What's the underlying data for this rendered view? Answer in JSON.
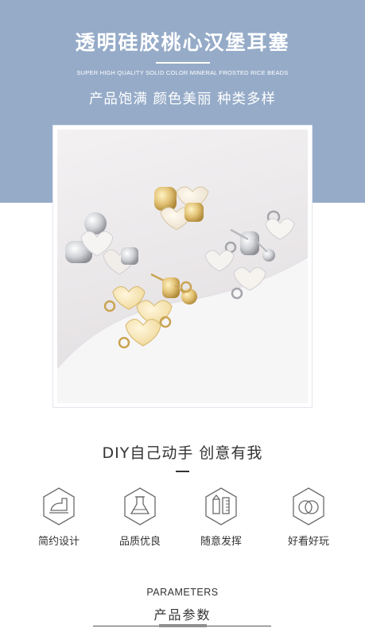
{
  "header": {
    "title": "透明硅胶桃心汉堡耳塞",
    "subtitle_en": "SUPER HIGH QUALITY SOLID COLOR MINERAL FROSTED RICE BEADS",
    "tagline": "产品饱满 颜色美丽 种类多样"
  },
  "diy": {
    "heading": "DIY自己动手 创意有我"
  },
  "features": [
    {
      "icon": "iron-icon",
      "label": "简约设计"
    },
    {
      "icon": "flask-icon",
      "label": "品质优良"
    },
    {
      "icon": "pencil-ruler-icon",
      "label": "随意发挥"
    },
    {
      "icon": "rings-icon",
      "label": "好看好玩"
    }
  ],
  "parameters": {
    "title_en": "PARAMETERS",
    "title_cn": "产品参数"
  },
  "colors": {
    "banner": "#95abc8",
    "text_dark": "#333333",
    "icon_stroke": "#6a6a6a"
  }
}
